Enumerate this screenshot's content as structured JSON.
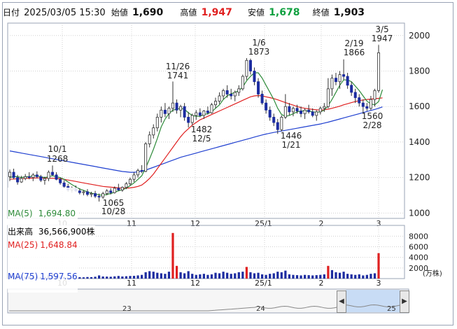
{
  "header": {
    "date_label": "日付",
    "datetime": "2025/03/05 15:30",
    "open_label": "始値",
    "open": "1,690",
    "high_label": "高値",
    "high": "1,947",
    "low_label": "安値",
    "low": "1,678",
    "close_label": "終値",
    "close": "1,903"
  },
  "legend": {
    "ma5": "MA(5)",
    "ma5_value": "1,694.80",
    "ma25": "MA(25)",
    "ma25_value": "1,648.84",
    "ma75": "MA(75)",
    "ma75_value": "1,597.56"
  },
  "volume": {
    "title": "出来高",
    "value": "36,566,900株",
    "unit": "(万株)",
    "yticks": [
      "8000",
      "6000",
      "4000",
      "2000"
    ]
  },
  "navigator": {
    "labels": [
      "23",
      "24",
      "25"
    ]
  },
  "colors": {
    "up_candle": "#ffffff",
    "down_candle": "#1c2ca0",
    "ma5": "#2e8b3a",
    "ma25": "#e02020",
    "ma75": "#2040d0",
    "volume_bar": "#1c2ca0",
    "volume_spike": "#e02020",
    "grid": "#d0d0d0"
  },
  "chart_data": {
    "type": "candlestick",
    "y_ticks": [
      "1000",
      "1200",
      "1400",
      "1600",
      "1800",
      "2000"
    ],
    "ylim": [
      970,
      2070
    ],
    "x_ticks": [
      "10",
      "11",
      "12",
      "25/1",
      "2",
      "3"
    ],
    "annotations": [
      {
        "text": "10/1",
        "value": "1268",
        "pos": "above"
      },
      {
        "text": "1065",
        "value": "10/28",
        "pos": "below"
      },
      {
        "text": "11/26",
        "value": "1741",
        "pos": "above"
      },
      {
        "text": "1482",
        "value": "12/5",
        "pos": "below"
      },
      {
        "text": "1/6",
        "value": "1873",
        "pos": "above"
      },
      {
        "text": "1446",
        "value": "1/21",
        "pos": "below"
      },
      {
        "text": "2/19",
        "value": "1866",
        "pos": "above"
      },
      {
        "text": "1560",
        "value": "2/28",
        "pos": "below"
      },
      {
        "text": "3/5",
        "value": "1947",
        "pos": "above"
      }
    ],
    "candles": [
      [
        1205,
        1245,
        1180,
        1230
      ],
      [
        1230,
        1250,
        1190,
        1200
      ],
      [
        1200,
        1215,
        1160,
        1175
      ],
      [
        1175,
        1210,
        1170,
        1195
      ],
      [
        1195,
        1220,
        1185,
        1205
      ],
      [
        1205,
        1230,
        1190,
        1200
      ],
      [
        1200,
        1225,
        1180,
        1215
      ],
      [
        1215,
        1235,
        1195,
        1205
      ],
      [
        1205,
        1215,
        1175,
        1185
      ],
      [
        1185,
        1205,
        1160,
        1195
      ],
      [
        1195,
        1240,
        1180,
        1230
      ],
      [
        1230,
        1268,
        1210,
        1215
      ],
      [
        1215,
        1230,
        1185,
        1190
      ],
      [
        1190,
        1200,
        1160,
        1170
      ],
      [
        1170,
        1185,
        1140,
        1150
      ],
      [
        1150,
        1165,
        1120,
        1130
      ],
      [
        1130,
        1150,
        1115,
        1140
      ],
      [
        1140,
        1155,
        1120,
        1125
      ],
      [
        1125,
        1140,
        1105,
        1115
      ],
      [
        1115,
        1130,
        1100,
        1120
      ],
      [
        1120,
        1135,
        1095,
        1105
      ],
      [
        1105,
        1120,
        1090,
        1110
      ],
      [
        1110,
        1125,
        1085,
        1095
      ],
      [
        1095,
        1110,
        1065,
        1090
      ],
      [
        1090,
        1120,
        1080,
        1110
      ],
      [
        1110,
        1135,
        1100,
        1125
      ],
      [
        1125,
        1140,
        1105,
        1115
      ],
      [
        1115,
        1150,
        1110,
        1140
      ],
      [
        1140,
        1165,
        1125,
        1130
      ],
      [
        1130,
        1150,
        1120,
        1145
      ],
      [
        1145,
        1175,
        1135,
        1165
      ],
      [
        1165,
        1200,
        1155,
        1190
      ],
      [
        1190,
        1230,
        1175,
        1215
      ],
      [
        1215,
        1250,
        1200,
        1240
      ],
      [
        1240,
        1270,
        1225,
        1235
      ],
      [
        1235,
        1400,
        1230,
        1390
      ],
      [
        1390,
        1460,
        1370,
        1440
      ],
      [
        1440,
        1500,
        1420,
        1480
      ],
      [
        1480,
        1560,
        1460,
        1540
      ],
      [
        1540,
        1600,
        1510,
        1580
      ],
      [
        1580,
        1620,
        1540,
        1560
      ],
      [
        1560,
        1600,
        1530,
        1590
      ],
      [
        1590,
        1741,
        1570,
        1620
      ],
      [
        1620,
        1640,
        1560,
        1580
      ],
      [
        1580,
        1610,
        1540,
        1600
      ],
      [
        1600,
        1620,
        1520,
        1540
      ],
      [
        1540,
        1570,
        1482,
        1510
      ],
      [
        1510,
        1560,
        1495,
        1550
      ],
      [
        1550,
        1580,
        1525,
        1565
      ],
      [
        1565,
        1590,
        1540,
        1550
      ],
      [
        1550,
        1580,
        1530,
        1575
      ],
      [
        1575,
        1600,
        1555,
        1565
      ],
      [
        1565,
        1620,
        1560,
        1610
      ],
      [
        1610,
        1650,
        1590,
        1630
      ],
      [
        1630,
        1680,
        1615,
        1660
      ],
      [
        1660,
        1700,
        1640,
        1690
      ],
      [
        1690,
        1720,
        1650,
        1670
      ],
      [
        1670,
        1700,
        1640,
        1660
      ],
      [
        1660,
        1690,
        1630,
        1680
      ],
      [
        1680,
        1720,
        1660,
        1700
      ],
      [
        1700,
        1780,
        1690,
        1770
      ],
      [
        1770,
        1873,
        1750,
        1860
      ],
      [
        1860,
        1870,
        1780,
        1800
      ],
      [
        1800,
        1820,
        1720,
        1740
      ],
      [
        1740,
        1760,
        1650,
        1670
      ],
      [
        1670,
        1690,
        1610,
        1620
      ],
      [
        1620,
        1640,
        1560,
        1580
      ],
      [
        1580,
        1600,
        1520,
        1540
      ],
      [
        1540,
        1560,
        1490,
        1510
      ],
      [
        1510,
        1530,
        1446,
        1470
      ],
      [
        1470,
        1550,
        1460,
        1540
      ],
      [
        1540,
        1670,
        1530,
        1600
      ],
      [
        1600,
        1620,
        1550,
        1570
      ],
      [
        1570,
        1600,
        1545,
        1590
      ],
      [
        1590,
        1610,
        1560,
        1575
      ],
      [
        1575,
        1600,
        1540,
        1560
      ],
      [
        1560,
        1590,
        1530,
        1580
      ],
      [
        1580,
        1610,
        1560,
        1570
      ],
      [
        1570,
        1590,
        1540,
        1550
      ],
      [
        1550,
        1580,
        1520,
        1570
      ],
      [
        1570,
        1600,
        1555,
        1590
      ],
      [
        1590,
        1620,
        1570,
        1600
      ],
      [
        1600,
        1760,
        1590,
        1700
      ],
      [
        1700,
        1780,
        1660,
        1760
      ],
      [
        1760,
        1790,
        1720,
        1740
      ],
      [
        1740,
        1800,
        1700,
        1780
      ],
      [
        1780,
        1866,
        1750,
        1770
      ],
      [
        1770,
        1790,
        1700,
        1720
      ],
      [
        1720,
        1740,
        1660,
        1680
      ],
      [
        1680,
        1700,
        1620,
        1650
      ],
      [
        1650,
        1670,
        1600,
        1620
      ],
      [
        1620,
        1640,
        1560,
        1600
      ],
      [
        1600,
        1620,
        1575,
        1590
      ],
      [
        1590,
        1660,
        1580,
        1640
      ],
      [
        1640,
        1700,
        1600,
        1690
      ],
      [
        1690,
        1947,
        1678,
        1903
      ]
    ],
    "ma5": [
      1200,
      1205,
      1205,
      1200,
      1205,
      1205,
      1210,
      1210,
      1205,
      1200,
      1205,
      1210,
      1205,
      1200,
      1190,
      1175,
      1160,
      1148,
      1135,
      1128,
      1120,
      1112,
      1108,
      1103,
      1100,
      1105,
      1110,
      1118,
      1125,
      1132,
      1140,
      1155,
      1170,
      1190,
      1210,
      1255,
      1305,
      1360,
      1420,
      1485,
      1530,
      1560,
      1580,
      1585,
      1590,
      1585,
      1565,
      1550,
      1545,
      1545,
      1555,
      1560,
      1570,
      1590,
      1610,
      1640,
      1660,
      1672,
      1680,
      1690,
      1710,
      1745,
      1770,
      1790,
      1790,
      1760,
      1720,
      1680,
      1640,
      1590,
      1555,
      1545,
      1550,
      1560,
      1570,
      1575,
      1575,
      1575,
      1570,
      1568,
      1570,
      1580,
      1605,
      1640,
      1680,
      1720,
      1750,
      1750,
      1740,
      1715,
      1690,
      1660,
      1630,
      1615,
      1610,
      1628,
      1695
    ],
    "ma25": [
      1190,
      1192,
      1193,
      1194,
      1195,
      1196,
      1197,
      1198,
      1198,
      1197,
      1197,
      1196,
      1195,
      1193,
      1190,
      1186,
      1182,
      1178,
      1174,
      1170,
      1166,
      1162,
      1158,
      1154,
      1150,
      1148,
      1146,
      1144,
      1142,
      1140,
      1140,
      1142,
      1145,
      1150,
      1158,
      1175,
      1195,
      1220,
      1250,
      1280,
      1310,
      1340,
      1370,
      1400,
      1430,
      1455,
      1475,
      1495,
      1510,
      1525,
      1535,
      1545,
      1555,
      1565,
      1575,
      1585,
      1595,
      1605,
      1615,
      1625,
      1635,
      1645,
      1655,
      1660,
      1662,
      1660,
      1655,
      1650,
      1645,
      1638,
      1630,
      1622,
      1615,
      1608,
      1600,
      1594,
      1590,
      1587,
      1584,
      1582,
      1580,
      1582,
      1585,
      1590,
      1596,
      1602,
      1610,
      1616,
      1622,
      1628,
      1633,
      1637,
      1640,
      1642,
      1644,
      1646,
      1649
    ],
    "ma75": [
      1350,
      1346,
      1342,
      1338,
      1334,
      1330,
      1326,
      1322,
      1318,
      1314,
      1310,
      1306,
      1302,
      1298,
      1294,
      1290,
      1286,
      1282,
      1278,
      1274,
      1270,
      1266,
      1262,
      1258,
      1254,
      1250,
      1246,
      1242,
      1238,
      1234,
      1232,
      1230,
      1230,
      1232,
      1236,
      1242,
      1250,
      1258,
      1266,
      1274,
      1282,
      1290,
      1298,
      1306,
      1314,
      1320,
      1326,
      1332,
      1338,
      1344,
      1350,
      1356,
      1362,
      1368,
      1374,
      1380,
      1386,
      1392,
      1398,
      1404,
      1410,
      1416,
      1422,
      1428,
      1434,
      1440,
      1445,
      1450,
      1454,
      1458,
      1462,
      1466,
      1470,
      1474,
      1478,
      1482,
      1486,
      1490,
      1494,
      1498,
      1502,
      1507,
      1512,
      1518,
      1524,
      1530,
      1536,
      1542,
      1548,
      1554,
      1560,
      1566,
      1572,
      1578,
      1584,
      1590,
      1598
    ],
    "volume": [
      600,
      500,
      400,
      420,
      380,
      450,
      400,
      350,
      300,
      320,
      650,
      900,
      500,
      400,
      300,
      250,
      300,
      280,
      260,
      240,
      300,
      280,
      350,
      600,
      400,
      380,
      350,
      420,
      500,
      400,
      450,
      500,
      520,
      600,
      700,
      1200,
      1400,
      1300,
      1100,
      1000,
      900,
      1300,
      8600,
      2400,
      1200,
      1000,
      1400,
      900,
      700,
      800,
      900,
      700,
      800,
      1100,
      1000,
      1300,
      1100,
      900,
      1000,
      1200,
      1300,
      2200,
      1200,
      1000,
      1100,
      800,
      700,
      900,
      1000,
      1300,
      1200,
      1500,
      800,
      700,
      650,
      600,
      700,
      650,
      600,
      650,
      700,
      800,
      2400,
      1600,
      1200,
      1100,
      1300,
      900,
      800,
      700,
      800,
      600,
      700,
      900,
      1000,
      4800
    ]
  }
}
